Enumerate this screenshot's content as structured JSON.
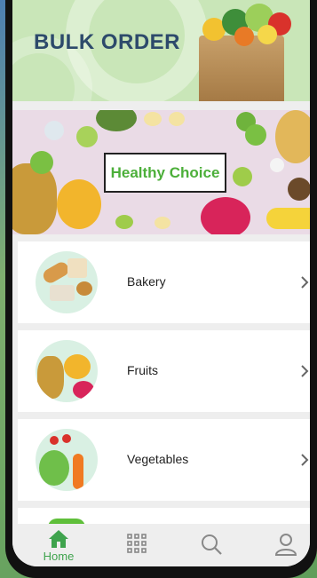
{
  "header": {
    "title": "BULK ORDER"
  },
  "banner": {
    "label": "Healthy Choice"
  },
  "categories": [
    {
      "label": "Bakery"
    },
    {
      "label": "Fruits"
    },
    {
      "label": "Vegetables"
    }
  ],
  "nav": {
    "home_label": "Home",
    "items": [
      "home-icon",
      "grid-icon",
      "search-icon",
      "profile-icon"
    ]
  },
  "colors": {
    "title": "#2d4a6b",
    "accent_green": "#4caf3a",
    "nav_active": "#3fa34d",
    "header_bg": "#c9e6b8"
  }
}
